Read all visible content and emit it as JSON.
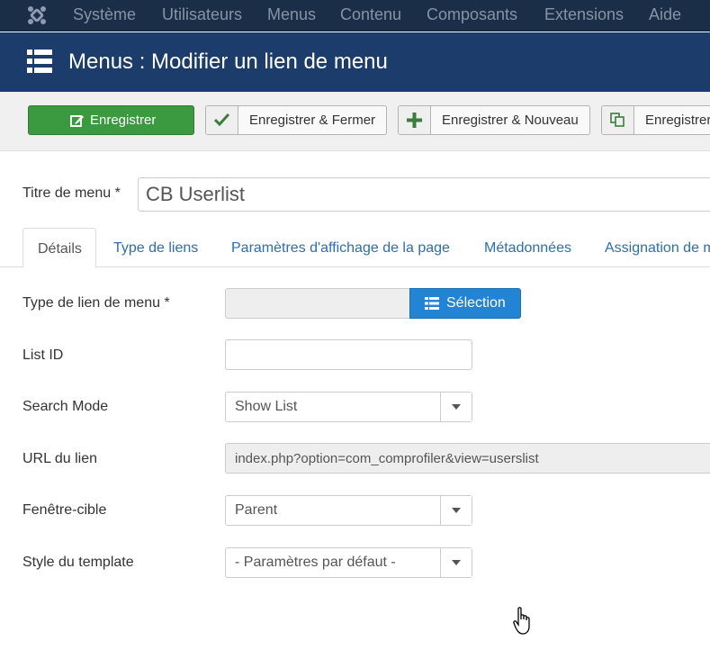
{
  "topnav": {
    "logo": "joomla-logo-icon",
    "items": [
      "Système",
      "Utilisateurs",
      "Menus",
      "Contenu",
      "Composants",
      "Extensions",
      "Aide"
    ]
  },
  "subhead": {
    "icon": "list-icon",
    "title": "Menus : Modifier un lien de menu"
  },
  "toolbar": {
    "save_label": "Enregistrer",
    "save_close_label": "Enregistrer & Fermer",
    "save_new_label": "Enregistrer & Nouveau",
    "save_copy_label": "Enregistrer"
  },
  "form": {
    "title_label": "Titre de menu *",
    "title_value": "CB Userlist",
    "tabs": [
      "Détails",
      "Type de liens",
      "Paramètres d'affichage de la page",
      "Métadonnées",
      "Assignation de m"
    ],
    "menu_type_label": "Type de lien de menu *",
    "menu_type_value": "",
    "select_button": "Sélection",
    "list_id_label": "List ID",
    "list_id_value": "",
    "search_mode_label": "Search Mode",
    "search_mode_value": "Show List",
    "url_label": "URL du lien",
    "url_value": "index.php?option=com_comprofiler&view=userslist",
    "target_label": "Fenêtre-cible",
    "target_value": "Parent",
    "template_label": "Style du template",
    "template_value": "- Paramètres par défaut -"
  },
  "colors": {
    "topnav_bg": "#1a2e47",
    "subhead_bg": "#1c3d6b",
    "save_green": "#3b9a3f",
    "select_blue": "#2384d3",
    "link_blue": "#2a6fb0"
  }
}
